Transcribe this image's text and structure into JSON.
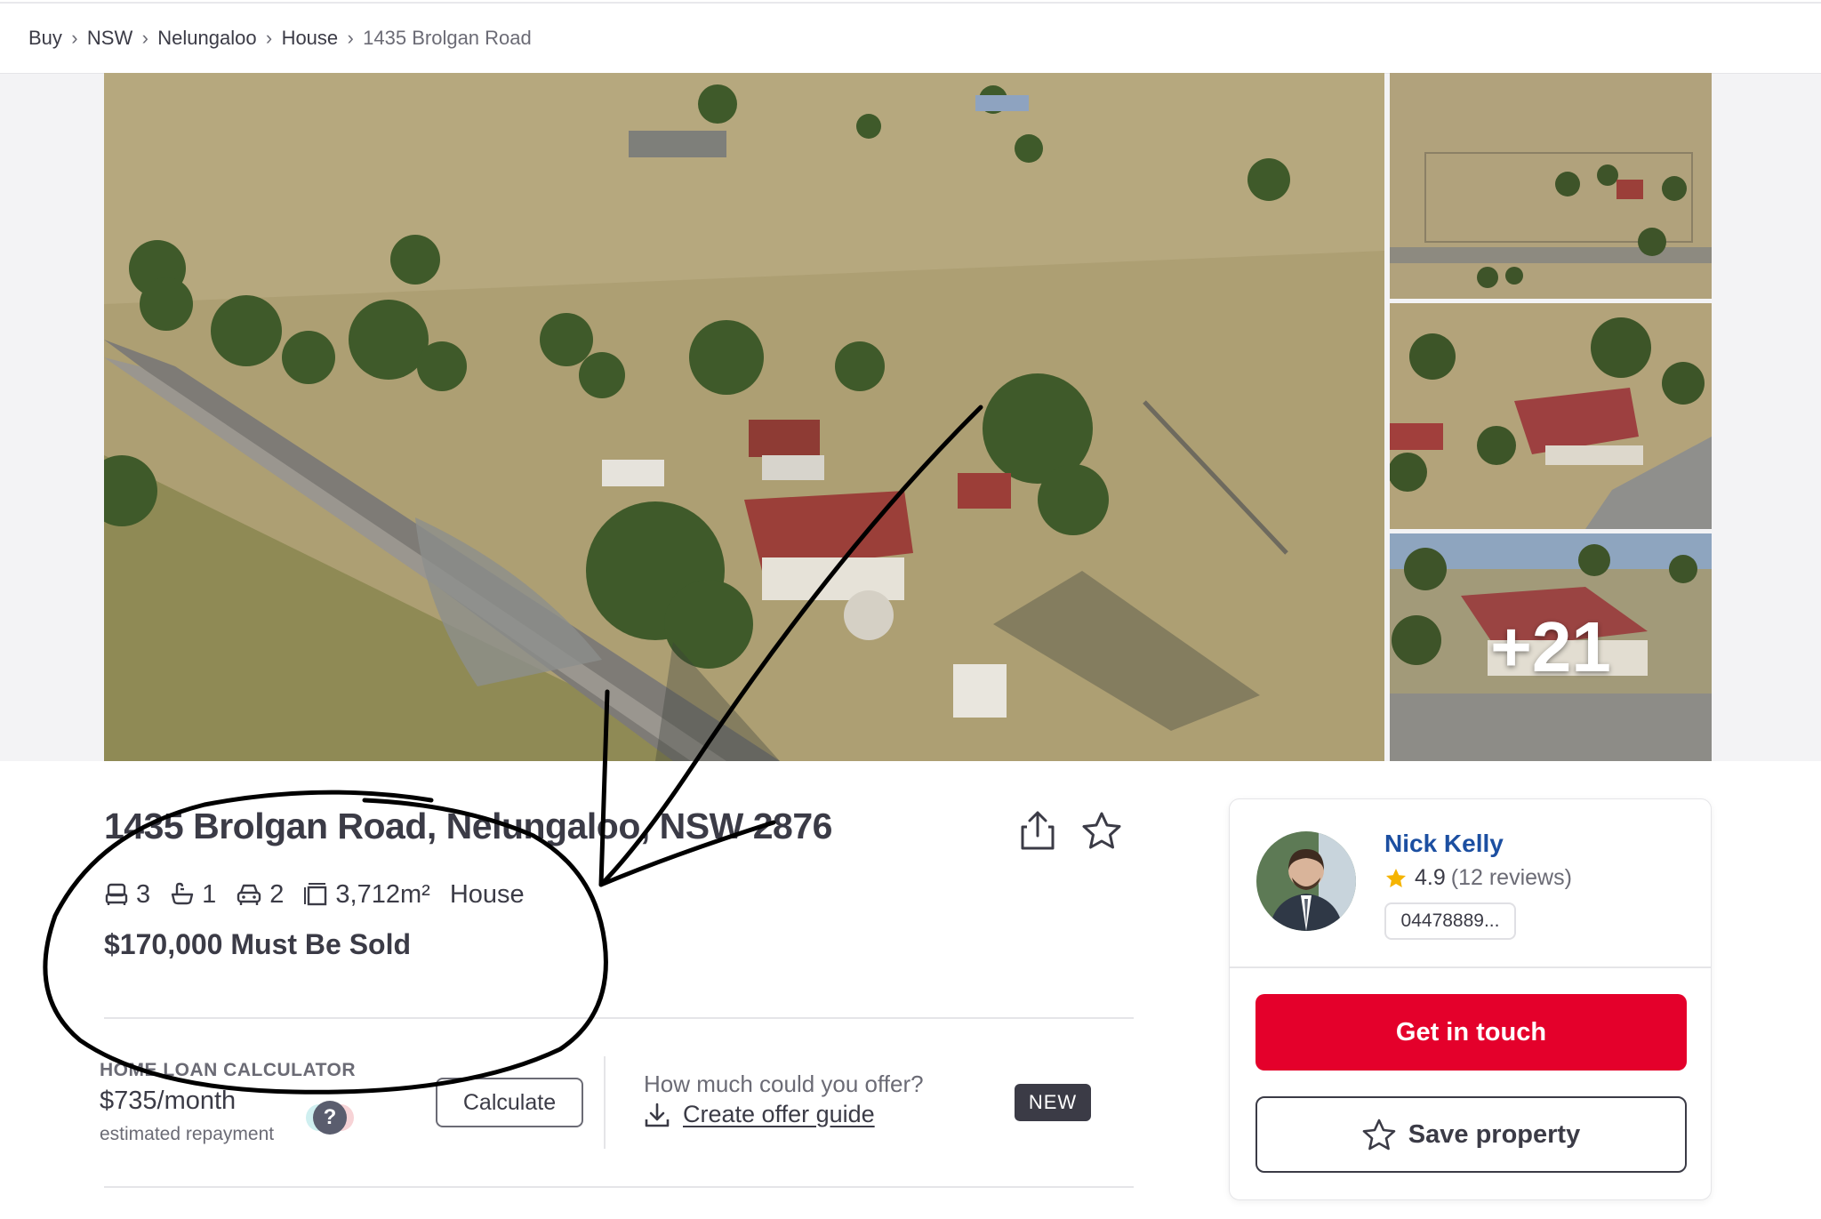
{
  "breadcrumb": {
    "items": [
      "Buy",
      "NSW",
      "Nelungaloo",
      "House"
    ],
    "current": "1435 Brolgan Road",
    "separator": "›"
  },
  "gallery": {
    "more_count": "+21",
    "photos": [
      "aerial-farm-photo",
      "aerial-house-top-photo",
      "aerial-house-closeup-photo",
      "house-roof-photo"
    ]
  },
  "listing": {
    "address": "1435 Brolgan Road, Nelungaloo, NSW 2876",
    "bedrooms": "3",
    "bathrooms": "1",
    "parking": "2",
    "land_size": "3,712m²",
    "property_type": "House",
    "price": "$170,000 Must Be Sold"
  },
  "calculator": {
    "heading": "HOME LOAN CALCULATOR",
    "amount": "$735/month",
    "sub": "estimated repayment",
    "help_glyph": "?",
    "button_label": "Calculate"
  },
  "offer": {
    "question": "How much could you offer?",
    "link_label": "Create offer guide",
    "badge": "NEW"
  },
  "agent": {
    "name": "Nick Kelly",
    "rating": "4.9",
    "reviews": "(12 reviews)",
    "phone": "04478889..."
  },
  "actions": {
    "contact_label": "Get in touch",
    "save_label": "Save property"
  },
  "colors": {
    "brand_red": "#e4002b",
    "agent_link_blue": "#1c4fa1",
    "text_dark": "#3b3b46",
    "star_gold": "#f5b400",
    "annotation_ink": "#000000"
  }
}
